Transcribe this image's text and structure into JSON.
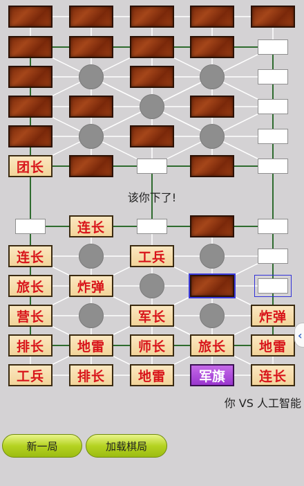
{
  "board": {
    "top_rows": [
      [
        {
          "type": "hidden"
        },
        {
          "type": "hidden"
        },
        {
          "type": "hidden"
        },
        {
          "type": "hidden"
        },
        {
          "type": "hidden"
        }
      ],
      [
        {
          "type": "hidden"
        },
        {
          "type": "hidden"
        },
        {
          "type": "hidden"
        },
        {
          "type": "hidden"
        },
        {
          "type": "empty"
        }
      ],
      [
        {
          "type": "hidden"
        },
        {
          "type": "camp"
        },
        {
          "type": "hidden"
        },
        {
          "type": "camp"
        },
        {
          "type": "empty"
        }
      ],
      [
        {
          "type": "hidden"
        },
        {
          "type": "hidden"
        },
        {
          "type": "camp"
        },
        {
          "type": "hidden"
        },
        {
          "type": "empty"
        }
      ],
      [
        {
          "type": "hidden"
        },
        {
          "type": "camp"
        },
        {
          "type": "hidden"
        },
        {
          "type": "camp"
        },
        {
          "type": "empty"
        }
      ],
      [
        {
          "type": "label",
          "text": "团长"
        },
        {
          "type": "hidden"
        },
        {
          "type": "empty"
        },
        {
          "type": "hidden"
        },
        {
          "type": "empty"
        }
      ]
    ],
    "bottom_rows": [
      [
        {
          "type": "empty"
        },
        {
          "type": "label",
          "text": "连长"
        },
        {
          "type": "empty"
        },
        {
          "type": "hidden"
        },
        {
          "type": "empty"
        }
      ],
      [
        {
          "type": "label",
          "text": "连长"
        },
        {
          "type": "camp"
        },
        {
          "type": "label",
          "text": "工兵"
        },
        {
          "type": "camp"
        },
        {
          "type": "empty"
        }
      ],
      [
        {
          "type": "label",
          "text": "旅长"
        },
        {
          "type": "label",
          "text": "炸弹"
        },
        {
          "type": "camp"
        },
        {
          "type": "hidden",
          "selected": true
        },
        {
          "type": "empty",
          "selected": true
        }
      ],
      [
        {
          "type": "label",
          "text": "营长"
        },
        {
          "type": "camp"
        },
        {
          "type": "label",
          "text": "军长"
        },
        {
          "type": "camp"
        },
        {
          "type": "label",
          "text": "炸弹"
        }
      ],
      [
        {
          "type": "label",
          "text": "排长"
        },
        {
          "type": "label",
          "text": "地雷"
        },
        {
          "type": "label",
          "text": "师长"
        },
        {
          "type": "label",
          "text": "旅长"
        },
        {
          "type": "label",
          "text": "地雷"
        }
      ],
      [
        {
          "type": "label",
          "text": "工兵"
        },
        {
          "type": "label",
          "text": "排长"
        },
        {
          "type": "label",
          "text": "地雷"
        },
        {
          "type": "flag",
          "text": "军旗"
        },
        {
          "type": "label",
          "text": "连长"
        }
      ]
    ]
  },
  "status": {
    "turn_message": "该你下了!",
    "versus": "你 VS 人工智能"
  },
  "buttons": {
    "new_game": "新一局",
    "load_game": "加载棋局"
  },
  "colors": {
    "railway": "#2e6b2e",
    "road": "#ffffff",
    "label_text": "#d8141a",
    "flag": "#9a36cf"
  },
  "icons": {
    "side_handle": "chevron-left-icon"
  }
}
